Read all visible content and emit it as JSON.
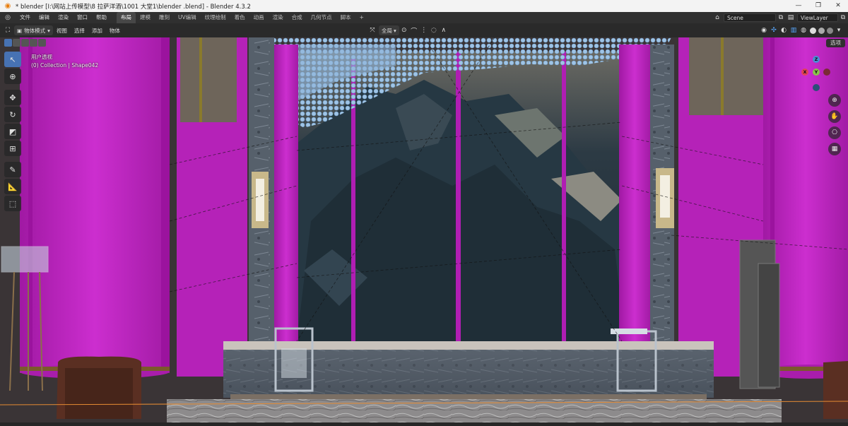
{
  "window": {
    "title": "* blender  [I:\\网站上传模型\\8 拉萨洋酒\\1001 大堂1\\blender .blend] - Blender 4.3.2",
    "min_label": "—",
    "restore_label": "❐",
    "close_label": "✕"
  },
  "topbar": {
    "menus": [
      "文件",
      "编辑",
      "渲染",
      "窗口",
      "帮助"
    ],
    "workspaces": [
      "布局",
      "建模",
      "雕刻",
      "UV编辑",
      "纹理绘制",
      "着色",
      "动画",
      "渲染",
      "合成",
      "几何节点",
      "脚本"
    ],
    "active_workspace": "布局",
    "add_tab": "+",
    "scene_name": "Scene",
    "view_layer": "ViewLayer"
  },
  "header": {
    "mode": "物体模式",
    "menus": [
      "视图",
      "选择",
      "添加",
      "物体"
    ],
    "orientation": "全局",
    "options_label": "选项"
  },
  "viewport": {
    "view_name": "用户透视",
    "collection_info": "(0) Collection | Shape042"
  },
  "gizmo": {
    "x_label": "X",
    "y_label": "Y",
    "z_label": "Z",
    "x_color": "#e34356",
    "y_color": "#8bc34a",
    "z_color": "#4a8ed6"
  },
  "icons": {
    "blender_logo": "blender-logo-icon",
    "tools": [
      "select-box-icon",
      "cursor-icon",
      "move-icon",
      "rotate-icon",
      "scale-icon",
      "transform-icon",
      "annotate-icon",
      "measure-icon",
      "add-cube-icon"
    ],
    "nav": [
      "zoom-icon",
      "hand-pan-icon",
      "camera-icon",
      "grid-ortho-icon"
    ]
  },
  "colors": {
    "magenta": "#c21fc4",
    "accent_blue": "#4772b3"
  }
}
